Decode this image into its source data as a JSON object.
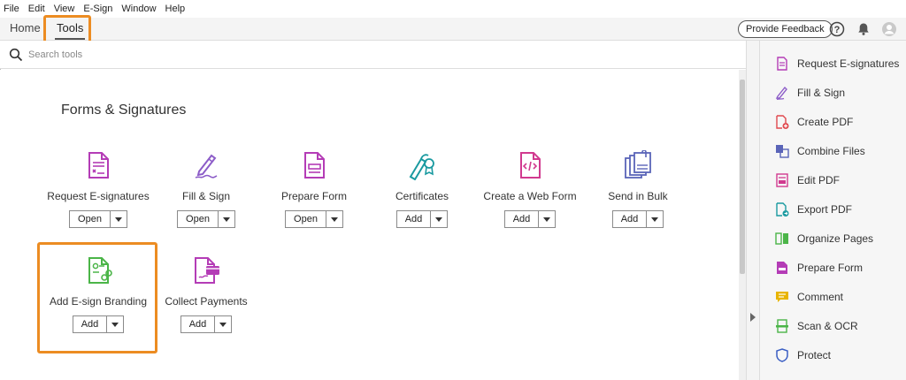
{
  "menu": [
    "File",
    "Edit",
    "View",
    "E-Sign",
    "Window",
    "Help"
  ],
  "tabs": {
    "home": "Home",
    "tools": "Tools"
  },
  "header": {
    "feedback": "Provide Feedback"
  },
  "search": {
    "placeholder": "Search tools"
  },
  "section": {
    "title": "Forms & Signatures"
  },
  "tools": [
    {
      "label": "Request E-signatures",
      "button": "Open"
    },
    {
      "label": "Fill & Sign",
      "button": "Open"
    },
    {
      "label": "Prepare Form",
      "button": "Open"
    },
    {
      "label": "Certificates",
      "button": "Add"
    },
    {
      "label": "Create a Web Form",
      "button": "Add"
    },
    {
      "label": "Send in Bulk",
      "button": "Add"
    },
    {
      "label": "Add E-sign Branding",
      "button": "Add"
    },
    {
      "label": "Collect Payments",
      "button": "Add"
    }
  ],
  "right_panel": [
    "Request E-signatures",
    "Fill & Sign",
    "Create PDF",
    "Combine Files",
    "Edit PDF",
    "Export PDF",
    "Organize Pages",
    "Prepare Form",
    "Comment",
    "Scan & OCR",
    "Protect"
  ],
  "colors": {
    "highlight": "#ec8c22",
    "magenta": "#b43cb6",
    "purple": "#8c5cc8",
    "red": "#e0484e",
    "teal": "#1a9aa0",
    "green": "#4bb548",
    "yellow": "#e8b400",
    "blue": "#3b5fc4"
  }
}
